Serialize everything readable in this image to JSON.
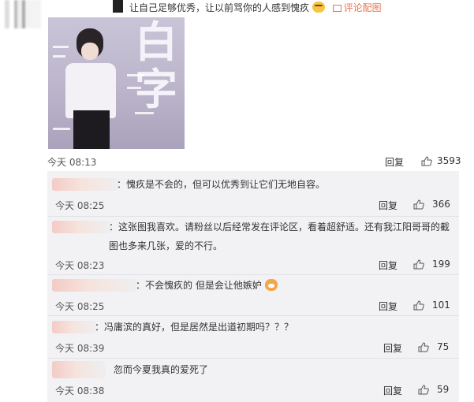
{
  "post": {
    "text": "让自己足够优秀，让以前骂你的人感到愧疚",
    "pic_link": "评论配图",
    "photo_char": "白字",
    "time": "今天 08:13",
    "reply": "回复",
    "likes": "3593"
  },
  "replies": [
    {
      "text": "：愧疚是不会的，但可以优秀到让它们无地自容。",
      "time": "今天 08:25",
      "reply": "回复",
      "likes": "366"
    },
    {
      "text": "：这张图我喜欢。请粉丝以后经常发在评论区，看着超舒适。还有我江阳哥哥的截图也多来几张，爱的不行。",
      "time": "今天 08:23",
      "reply": "回复",
      "likes": "199"
    },
    {
      "text": "：不会愧疚的 但是会让他嫉妒",
      "time": "今天 08:25",
      "reply": "回复",
      "likes": "101"
    },
    {
      "text": "：冯庸滨的真好，但是居然是出道初期吗？？？",
      "time": "今天 08:39",
      "reply": "回复",
      "likes": "75"
    },
    {
      "text": "忽而今夏我真的爱死了",
      "time": "今天 08:38",
      "reply": "回复",
      "likes": "59"
    }
  ],
  "colors": {
    "link": "#eb7350",
    "reply_bg": "#f2f2f5"
  }
}
